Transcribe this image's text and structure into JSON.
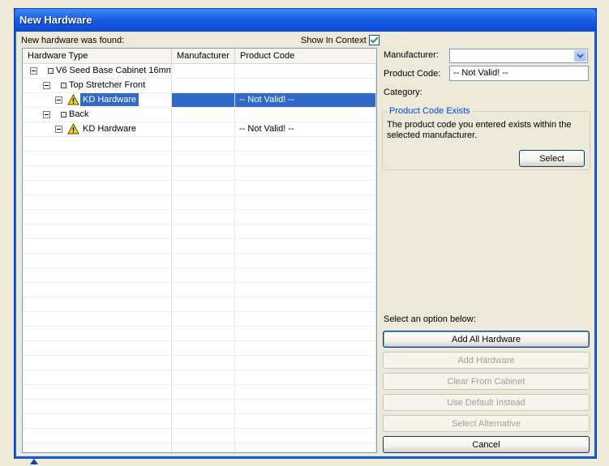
{
  "window": {
    "title": "New Hardware"
  },
  "left": {
    "found_label": "New hardware was found:",
    "show_in_context": {
      "label": "Show In Context",
      "checked": true
    },
    "columns": [
      "Hardware Type",
      "Manufacturer",
      "Product Code"
    ],
    "rows": [
      {
        "name": "V6 Seed Base Cabinet 16mm",
        "manufacturer": "",
        "product_code": ""
      },
      {
        "name": "Top Stretcher Front",
        "manufacturer": "",
        "product_code": ""
      },
      {
        "name": "KD Hardware",
        "manufacturer": "",
        "product_code": "-- Not Valid! --",
        "icon": "warning-icon",
        "selected": true
      },
      {
        "name": "Back",
        "manufacturer": "",
        "product_code": ""
      },
      {
        "name": "KD Hardware",
        "manufacturer": "",
        "product_code": "-- Not Valid! --",
        "icon": "warning-icon"
      }
    ]
  },
  "right": {
    "manufacturer_label": "Manufacturer:",
    "manufacturer_value": "",
    "product_code_label": "Product Code:",
    "product_code_value": "-- Not Valid! --",
    "category_label": "Category:",
    "group": {
      "title": "Product Code Exists",
      "description": "The product code you entered exists within the selected manufacturer.",
      "select_button": "Select"
    },
    "option_prompt": "Select an option below:",
    "buttons": {
      "add_all": "Add All Hardware",
      "add": "Add Hardware",
      "clear": "Clear From Cabinet",
      "use_default": "Use Default Instead",
      "select_alternative": "Select Alternative",
      "cancel": "Cancel"
    }
  },
  "colors": {
    "selection": "#316AC5",
    "title_bar": "#0A4AD6",
    "group_title": "#0046D5"
  }
}
